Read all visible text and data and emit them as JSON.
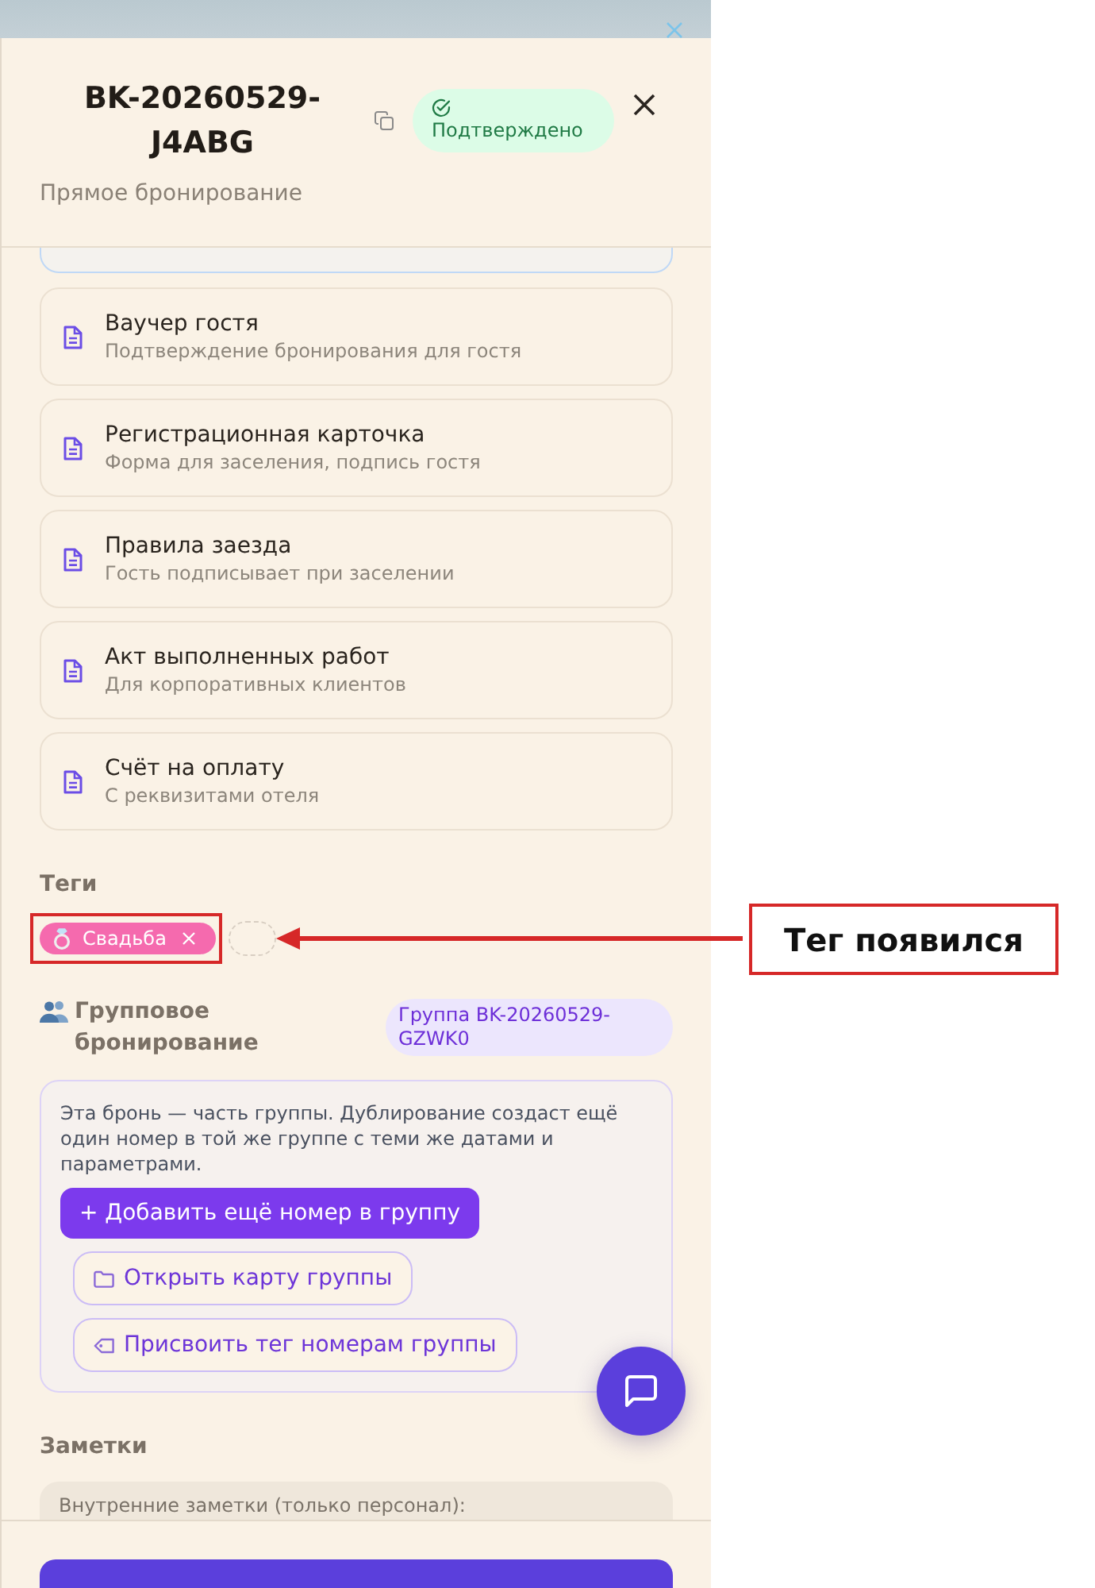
{
  "header": {
    "title": "BK-20260529-J4ABG",
    "status": {
      "label": "Подтверждено",
      "kind": "confirmed"
    },
    "subtitle": "Прямое бронирование"
  },
  "documents": [
    {
      "title": "Ваучер гостя",
      "description": "Подтверждение бронирования для гостя"
    },
    {
      "title": "Регистрационная карточка",
      "description": "Форма для заселения, подпись гостя"
    },
    {
      "title": "Правила заезда",
      "description": "Гость подписывает при заселении"
    },
    {
      "title": "Акт выполненных работ",
      "description": "Для корпоративных клиентов"
    },
    {
      "title": "Счёт на оплату",
      "description": "С реквизитами отеля"
    }
  ],
  "tags": {
    "heading": "Теги",
    "items": [
      {
        "label": "Свадьба",
        "color": "#f56aae"
      }
    ]
  },
  "group": {
    "heading": "Групповое бронирование",
    "badge": "Группа BK-20260529-GZWK0",
    "note": "Эта бронь — часть группы. Дублирование создаст ещё один номер в той же группе с теми же датами и параметрами.",
    "buttons": [
      {
        "label": "+ Добавить ещё номер в группу",
        "kind": "primary"
      },
      {
        "label": "Открыть карту группы",
        "kind": "outline"
      },
      {
        "label": "Присвоить тег номерам группы",
        "kind": "outline"
      }
    ]
  },
  "notes": {
    "heading": "Заметки",
    "value": "Внутренние заметки (только персонал):"
  },
  "annotation": {
    "label": "Тег появился"
  }
}
